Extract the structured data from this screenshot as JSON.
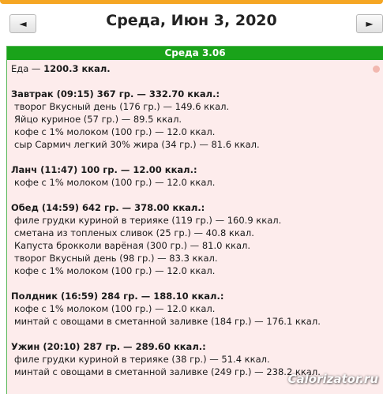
{
  "header": {
    "prev_label": "◄",
    "date_title": "Среда, Июн 3, 2020",
    "next_label": "►"
  },
  "day": {
    "bar_label": "Среда 3.06",
    "total_prefix": "Еда — ",
    "total_value": "1200.3 ккал."
  },
  "meals": [
    {
      "header": "Завтрак (09:15) 367 гр. — 332.70 ккал.:",
      "items": [
        "творог Вкусный день (176 гр.) — 149.6 ккал.",
        "Яйцо куриное (57 гр.) — 89.5 ккал.",
        "кофе с 1% молоком (100 гр.) — 12.0 ккал.",
        "сыр Сармич легкий 30% жира (34 гр.) — 81.6 ккал."
      ]
    },
    {
      "header": "Ланч (11:47) 100 гр. — 12.00 ккал.:",
      "items": [
        "кофе с 1% молоком (100 гр.) — 12.0 ккал."
      ]
    },
    {
      "header": "Обед (14:59) 642 гр. — 378.00 ккал.:",
      "items": [
        "филе грудки куриной в терияке (119 гр.) — 160.9 ккал.",
        "сметана из топленых сливок (25 гр.) — 40.8 ккал.",
        "Капуста брокколи варёная (300 гр.) — 81.0 ккал.",
        "творог Вкусный день (98 гр.) — 83.3 ккал.",
        "кофе с 1% молоком (100 гр.) — 12.0 ккал."
      ]
    },
    {
      "header": "Полдник (16:59) 284 гр. — 188.10 ккал.:",
      "items": [
        "кофе с 1% молоком (100 гр.) — 12.0 ккал.",
        "минтай с овощами в сметанной заливке (184 гр.) — 176.1 ккал."
      ]
    },
    {
      "header": "Ужин (20:10) 287 гр. — 289.60 ккал.:",
      "items": [
        "филе грудки куриной в терияке (38 гр.) — 51.4 ккал.",
        "минтай с овощами в сметанной заливке (249 гр.) — 238.2 ккал."
      ]
    }
  ],
  "watermark": "Calorizator.ru",
  "colors": {
    "top_strip": "#f5a623",
    "day_bar": "#1aa31a",
    "panel_bg": "#fdecec",
    "panel_border": "#5ab85a"
  },
  "icons": {
    "corner": "apple-icon"
  }
}
